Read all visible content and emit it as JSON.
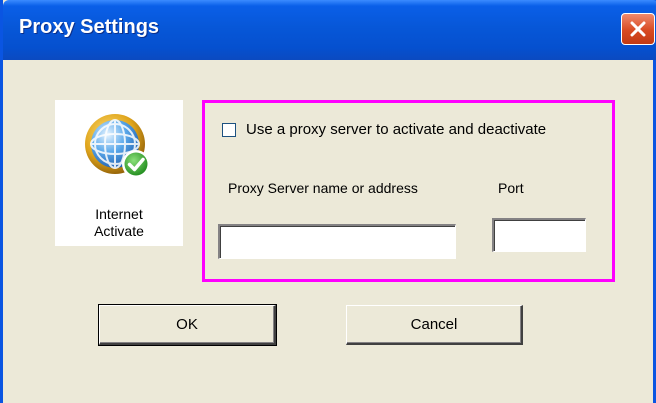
{
  "window": {
    "title": "Proxy Settings",
    "title_color": "#ffffff",
    "titlebar_color": "#0757d8"
  },
  "app": {
    "icon": "globe-check-icon",
    "label_line1": "Internet",
    "label_line2": "Activate"
  },
  "proxy": {
    "use_proxy_label": "Use a proxy server to activate and deactivate",
    "use_proxy_checked": false,
    "server_label": "Proxy Server name or address",
    "server_value": "",
    "port_label": "Port",
    "port_value": "",
    "highlight_color": "#ff00ff"
  },
  "buttons": {
    "ok_label": "OK",
    "cancel_label": "Cancel"
  }
}
